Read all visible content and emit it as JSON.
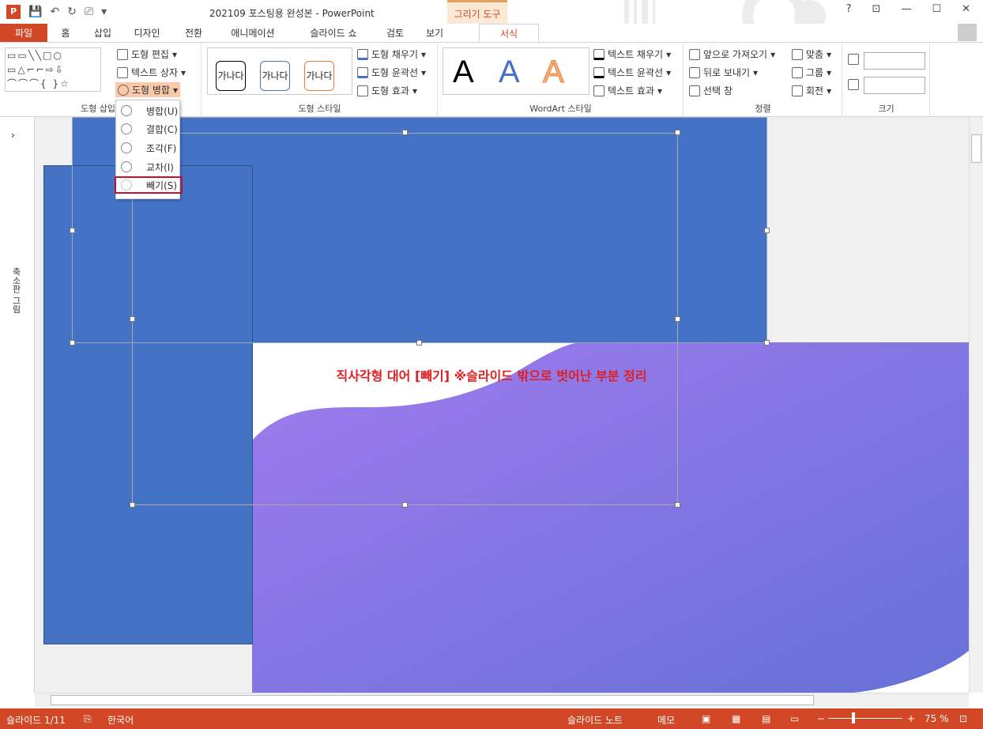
{
  "window": {
    "title": "202109 포스팅용 완성본 - PowerPoint",
    "context_tab": "그리기 도구",
    "help": "?",
    "restore_ribbon": "⊡",
    "minimize": "—",
    "maximize": "☐",
    "close": "✕"
  },
  "tabs": [
    "파일",
    "홈",
    "삽입",
    "디자인",
    "전환",
    "애니메이션",
    "슬라이드 쇼",
    "검토",
    "보기",
    "서식"
  ],
  "ribbon": {
    "insert_shapes": {
      "label": "도형 삽입",
      "edit_shape": "도형 편집",
      "text_box": "텍스트 상자",
      "merge_shapes": "도형 병합"
    },
    "shape_styles": {
      "label": "도형 스타일",
      "sample": "가나다",
      "fill": "도형 채우기",
      "outline": "도형 윤곽선",
      "effects": "도형 효과"
    },
    "wordart": {
      "label": "WordArt 스타일",
      "letter": "A",
      "text_fill": "텍스트 채우기",
      "text_outline": "텍스트 윤곽선",
      "text_effects": "텍스트 효과"
    },
    "arrange": {
      "label": "정렬",
      "bring_forward": "앞으로 가져오기",
      "send_backward": "뒤로 보내기",
      "selection_pane": "선택 창",
      "align": "맞춤",
      "group": "그룹",
      "rotate": "회전"
    },
    "size": {
      "label": "크기"
    }
  },
  "merge_menu": {
    "items": [
      "병합(U)",
      "결합(C)",
      "조각(F)",
      "교차(I)",
      "빼기(S)"
    ],
    "highlighted": "빼기(S)"
  },
  "left_pane": {
    "collapsed_label": "축소판 그림",
    "expand": "›"
  },
  "slide": {
    "caption": "직사각형 대어 [빼기] ※슬라이드 밖으로 벗어난 부분 정리"
  },
  "status": {
    "slide_info": "슬라이드 1/11",
    "language": "한국어",
    "notes": "슬라이드 노트",
    "comments": "메모",
    "zoom": "75 %"
  },
  "colors": {
    "accent": "#d24726",
    "shape_blue": "#4472c4",
    "gradient_start": "#9b7aee",
    "gradient_end": "#6a72d9",
    "caption_red": "#e21e1e"
  }
}
